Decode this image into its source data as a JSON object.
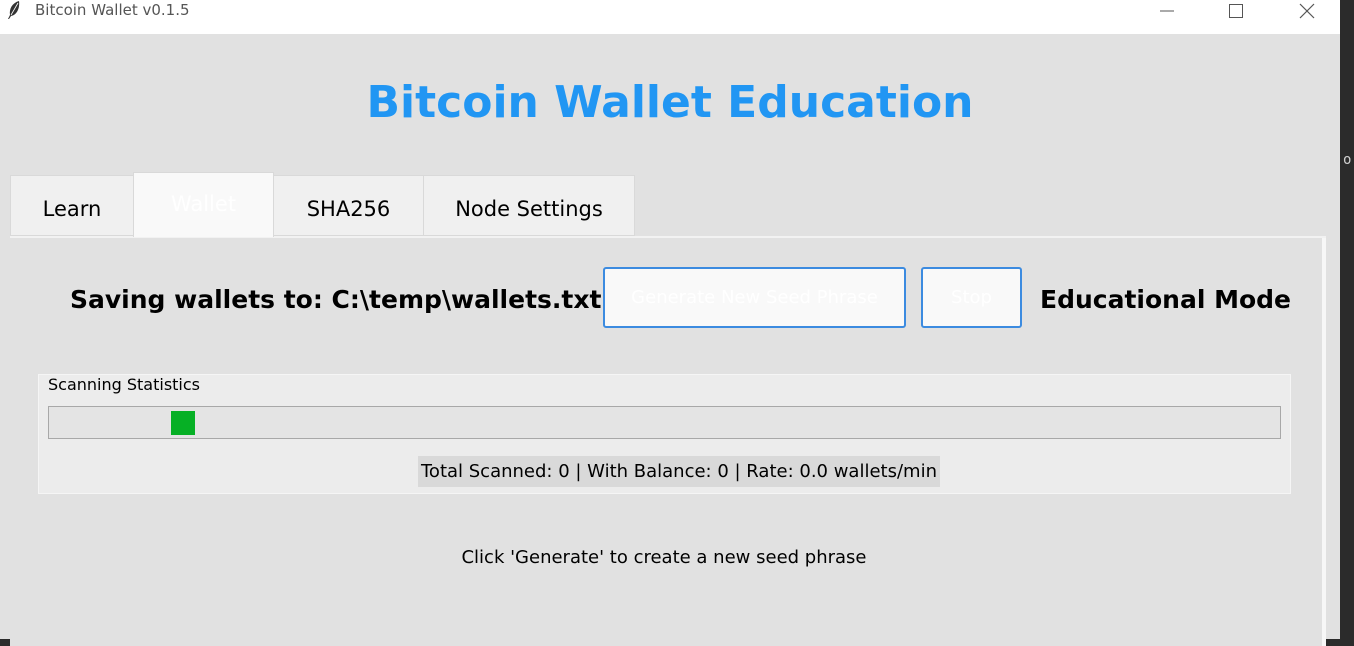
{
  "window": {
    "title": "Bitcoin Wallet v0.1.5",
    "icon": "feather-icon"
  },
  "header": {
    "title": "Bitcoin Wallet Education",
    "title_color": "#2196f3"
  },
  "tabs": [
    {
      "label": "Learn",
      "selected": false
    },
    {
      "label": "Wallet",
      "selected": true
    },
    {
      "label": "SHA256",
      "selected": false
    },
    {
      "label": "Node Settings",
      "selected": false
    }
  ],
  "wallet": {
    "saving_label": "Saving wallets to: C:\\temp\\wallets.txt",
    "generate_button": "Generate New Seed Phrase",
    "stop_button": "Stop",
    "mode_label": "Educational Mode"
  },
  "stats": {
    "legend": "Scanning Statistics",
    "progress_mode": "indeterminate",
    "progress_color": "#06b025",
    "summary": "Total Scanned: 0 | With Balance: 0 | Rate: 0.0 wallets/min"
  },
  "hint": "Click 'Generate' to create a new seed phrase",
  "edge_glyph": "o"
}
